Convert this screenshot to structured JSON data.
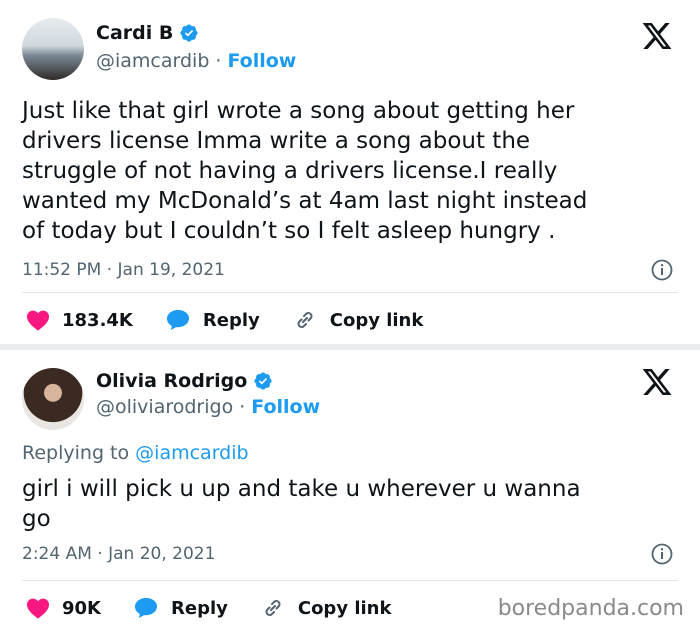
{
  "tweet1": {
    "name": "Cardi B",
    "handle": "@iamcardib",
    "dot": "·",
    "follow": "Follow",
    "line1": "Just like that girl wrote a song about getting her",
    "line2": "drivers license Imma write a song about the",
    "line3": "struggle of not having a drivers license.I really",
    "line4": "wanted my McDonald’s at 4am last night instead",
    "line5": "of today but I couldn’t so I felt asleep hungry .",
    "timestamp": "11:52 PM · Jan 19, 2021",
    "likes": "183.4K",
    "reply": "Reply",
    "copy": "Copy link"
  },
  "tweet2": {
    "name": "Olivia Rodrigo",
    "handle": "@oliviarodrigo",
    "dot": "·",
    "follow": "Follow",
    "replying_prefix": "Replying to",
    "replying_handle": "@iamcardib",
    "line1": "girl i will pick u up and take u wherever u wanna",
    "line2": "go",
    "timestamp": "2:24 AM · Jan 20, 2021",
    "likes": "90K",
    "reply": "Reply",
    "copy": "Copy link"
  },
  "watermark": "boredpanda.com",
  "colors": {
    "accent": "#1d9bf0",
    "like": "#f91880",
    "muted": "#536471"
  },
  "icons": [
    "verified-badge-icon",
    "x-logo-icon",
    "info-icon",
    "heart-icon",
    "reply-bubble-icon",
    "link-icon"
  ]
}
